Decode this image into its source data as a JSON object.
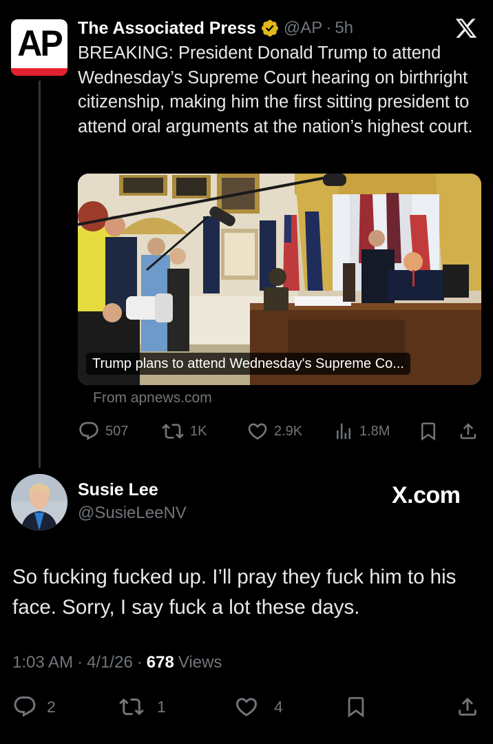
{
  "quoted": {
    "avatar_text": "AP",
    "name": "The Associated Press",
    "handle": "@AP",
    "separator": "·",
    "time": "5h",
    "text": "BREAKING: President Donald Trump to attend Wednesday’s Supreme Court hearing on birthright citizenship, making him the first sitting president to attend oral arguments at the nation’s highest court.",
    "card_caption": "Trump plans to attend Wednesday's Supreme Co...",
    "source": "From apnews.com",
    "actions": {
      "replies": "507",
      "reposts": "1K",
      "likes": "2.9K",
      "views": "1.8M"
    }
  },
  "post": {
    "name": "Susie Lee",
    "handle": "@SusieLeeNV",
    "watermark": "X.com",
    "text": "So fucking fucked up.  I’ll pray they fuck him to his face. Sorry, I say fuck a lot these days.",
    "time": "1:03 AM",
    "date": "4/1/26",
    "separator": "·",
    "views_count": "678",
    "views_label": "Views",
    "actions": {
      "replies": "2",
      "reposts": "1",
      "likes": "4"
    }
  },
  "colors": {
    "background": "#000000",
    "text_primary": "#e7e9ea",
    "text_secondary": "#71767b",
    "verified_gold": "#e2b719",
    "ap_red": "#e4202e"
  }
}
